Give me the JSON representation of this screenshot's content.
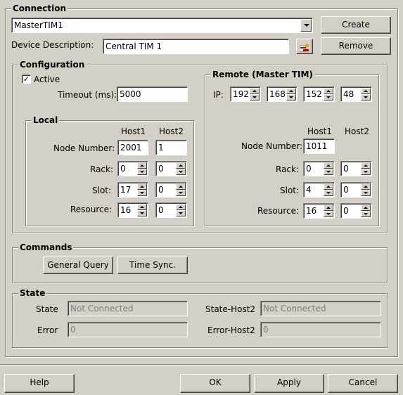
{
  "connection": {
    "legend": "Connection",
    "selected": "MasterTIM1",
    "create_label": "Create",
    "remove_label": "Remove",
    "device_description_label": "Device Description:",
    "device_description_value": "Central TIM 1"
  },
  "configuration": {
    "legend": "Configuration",
    "active_label": "Active",
    "active_checked": true,
    "timeout_label": "Timeout (ms):",
    "timeout_value": "5000",
    "local": {
      "legend": "Local",
      "host1_header": "Host1",
      "host2_header": "Host2",
      "node_number_label": "Node Number:",
      "node_number_host1": "2001",
      "node_number_host2": "1",
      "rack_label": "Rack:",
      "rack_host1": "0",
      "rack_host2": "0",
      "slot_label": "Slot:",
      "slot_host1": "17",
      "slot_host2": "0",
      "resource_label": "Resource:",
      "resource_host1": "16",
      "resource_host2": "0"
    },
    "remote": {
      "legend": "Remote (Master TIM)",
      "ip_label": "IP:",
      "ip_octets": [
        "192",
        "168",
        "152",
        "48"
      ],
      "host1_header": "Host1",
      "host2_header": "Host2",
      "node_number_label": "Node Number:",
      "node_number_host1": "1011",
      "rack_label": "Rack:",
      "rack_host1": "0",
      "rack_host2": "0",
      "slot_label": "Slot:",
      "slot_host1": "4",
      "slot_host2": "0",
      "resource_label": "Resource:",
      "resource_host1": "16",
      "resource_host2": "0"
    }
  },
  "commands": {
    "legend": "Commands",
    "general_query_label": "General Query",
    "time_sync_label": "Time Sync."
  },
  "state": {
    "legend": "State",
    "state_label": "State",
    "state_value": "Not Connected",
    "state_host2_label": "State-Host2",
    "state_host2_value": "Not Connected",
    "error_label": "Error",
    "error_value": "0",
    "error_host2_label": "Error-Host2",
    "error_host2_value": "0"
  },
  "footer": {
    "help_label": "Help",
    "ok_label": "OK",
    "apply_label": "Apply",
    "cancel_label": "Cancel"
  },
  "icons": {
    "browse": "device-browse-icon"
  }
}
